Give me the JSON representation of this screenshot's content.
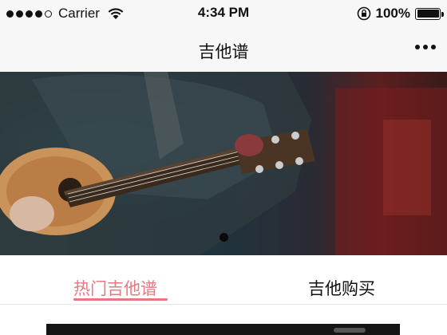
{
  "status_bar": {
    "carrier": "Carrier",
    "time": "4:34 PM",
    "battery_percent": "100%",
    "signal_bars_filled": 4,
    "signal_bars_total": 5,
    "battery_level": 1.0
  },
  "nav": {
    "title": "吉他谱",
    "more_icon": "more-dots-icon"
  },
  "banner": {
    "image_subject": "guitar-headstock-photo",
    "slide_count": 1,
    "active_slide": 1
  },
  "tabs": [
    {
      "label": "热门吉他谱",
      "active": true
    },
    {
      "label": "吉他购买",
      "active": false
    }
  ],
  "colors": {
    "accent": "#e8787f",
    "bar_background": "#f7f7f7",
    "text": "#111111"
  }
}
